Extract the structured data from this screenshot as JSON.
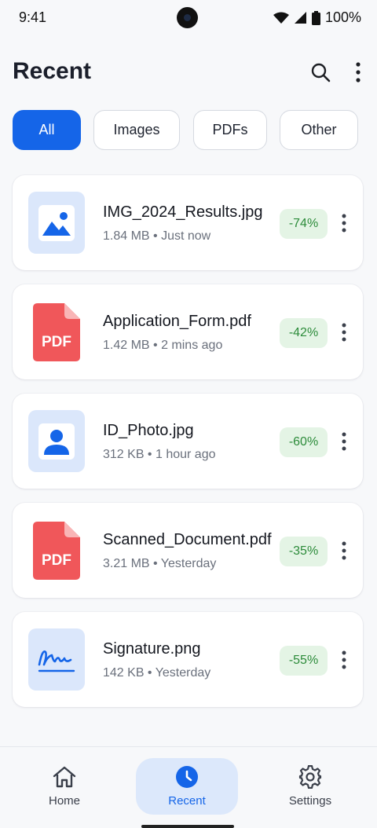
{
  "status_bar": {
    "time": "9:41",
    "battery": "100%"
  },
  "header": {
    "title": "Recent",
    "search_icon": "search-icon",
    "more_icon": "more-vertical-icon"
  },
  "filters": [
    {
      "label": "All",
      "active": true
    },
    {
      "label": "Images",
      "active": false
    },
    {
      "label": "PDFs",
      "active": false
    },
    {
      "label": "Other",
      "active": false
    }
  ],
  "files": [
    {
      "name": "IMG_2024_Results.jpg",
      "size": "1.84 MB",
      "time": "Just now",
      "savings": "-74%",
      "icon": "image-icon"
    },
    {
      "name": "Application_Form.pdf",
      "size": "1.42 MB",
      "time": "2 mins ago",
      "savings": "-42%",
      "icon": "pdf-icon"
    },
    {
      "name": "ID_Photo.jpg",
      "size": "312 KB",
      "time": "1 hour ago",
      "savings": "-60%",
      "icon": "person-icon"
    },
    {
      "name": "Scanned_Document.pdf",
      "size": "3.21 MB",
      "time": "Yesterday",
      "savings": "-35%",
      "icon": "pdf-icon"
    },
    {
      "name": "Signature.png",
      "size": "142 KB",
      "time": "Yesterday",
      "savings": "-55%",
      "icon": "signature-icon"
    }
  ],
  "file_meta_text": [
    "1.84 MB • Just now",
    "1.42 MB • 2 mins ago",
    "312 KB • 1 hour ago",
    "3.21 MB • Yesterday",
    "142 KB • Yesterday"
  ],
  "pdf_label": "PDF",
  "bottom_nav": {
    "home": "Home",
    "recent": "Recent",
    "settings": "Settings",
    "active": "recent"
  },
  "colors": {
    "accent": "#1565e8",
    "pdf_red": "#f0575a",
    "savings_green": "#2c8b3a",
    "savings_bg": "#e4f4e5",
    "thumb_bg": "#dbe7fb"
  }
}
